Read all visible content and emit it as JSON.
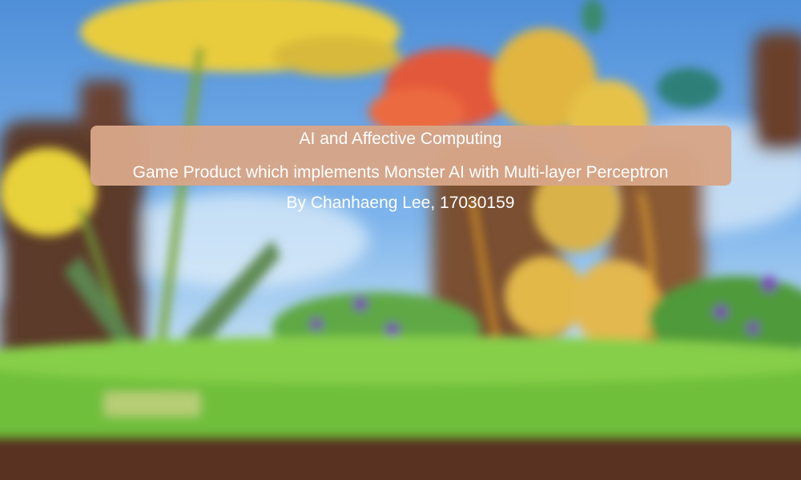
{
  "title": {
    "heading": "AI and Affective Computing",
    "subtitle": "Game Product which implements Monster AI with Multi-layer Perceptron",
    "author": "By Chanhaeng Lee, 17030159"
  },
  "colors": {
    "panel": "#d7a587",
    "text": "#ffffff",
    "sky": "#7db4ec",
    "grass": "#6fbf3a"
  }
}
